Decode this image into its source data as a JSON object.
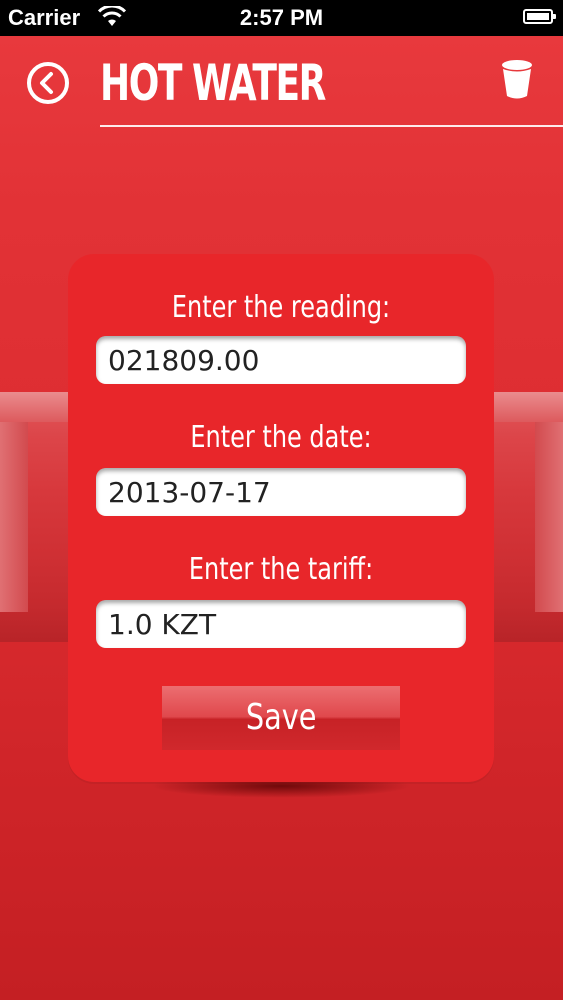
{
  "status_bar": {
    "carrier": "Carrier",
    "time": "2:57 PM",
    "icons": [
      "wifi-icon",
      "battery-icon"
    ]
  },
  "header": {
    "title": "HOT WATER",
    "back_icon": "chevron-left-circle-icon",
    "action_icon": "trash-icon"
  },
  "form": {
    "reading_label": "Enter the reading:",
    "reading_value": "021809.00",
    "date_label": "Enter the date:",
    "date_value": "2013-07-17",
    "tariff_label": "Enter the tariff:",
    "tariff_value": "1.0 KZT",
    "save_label": "Save"
  },
  "colors": {
    "background": "#dc2c30",
    "card": "#e8262a",
    "text": "#ffffff"
  }
}
